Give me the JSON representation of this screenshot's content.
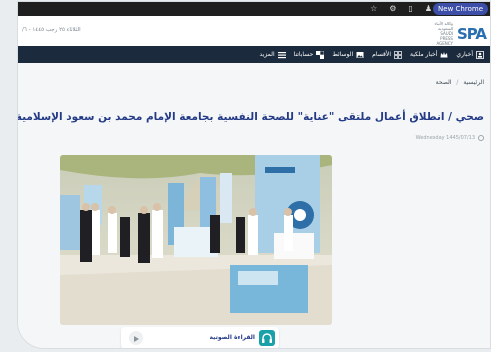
{
  "browser": {
    "new_chrome_label": "New Chrome",
    "toolbar_icons": [
      "star-icon",
      "extension-icon",
      "sidebar-icon",
      "profile-icon"
    ]
  },
  "header": {
    "date_text": "الثلاثاء ٢٥ رجب ١٤٤٥ - ٦/",
    "logo_text": "SPA",
    "logo_sub": "وكالة الأنباء السعودية SAUDI PRESS AGENCY"
  },
  "nav": {
    "items": [
      {
        "label": "أخباري",
        "icon": "user-icon"
      },
      {
        "label": "أخبار ملكية",
        "icon": "crown-icon"
      },
      {
        "label": "الأقسام",
        "icon": "grid-icon"
      },
      {
        "label": "الوسائط",
        "icon": "image-icon"
      },
      {
        "label": "حساباتنا",
        "icon": "share-icon"
      },
      {
        "label": "المزيد",
        "icon": "menu-icon"
      }
    ]
  },
  "breadcrumb": {
    "home": "الرئيسية",
    "separator": "/",
    "section": "الصحة"
  },
  "article": {
    "title": "صحي / انطلاق أعمال ملتقى \"عناية\" للصحة النفسية بجامعة الإمام محمد بن سعود الإسلامية",
    "date": "Wednesday 1445/07/13"
  },
  "audio": {
    "label": "القراءة الصوتية"
  },
  "colors": {
    "navbar": "#1b2b3d",
    "title": "#233a87",
    "accent": "#1aa0a8"
  }
}
